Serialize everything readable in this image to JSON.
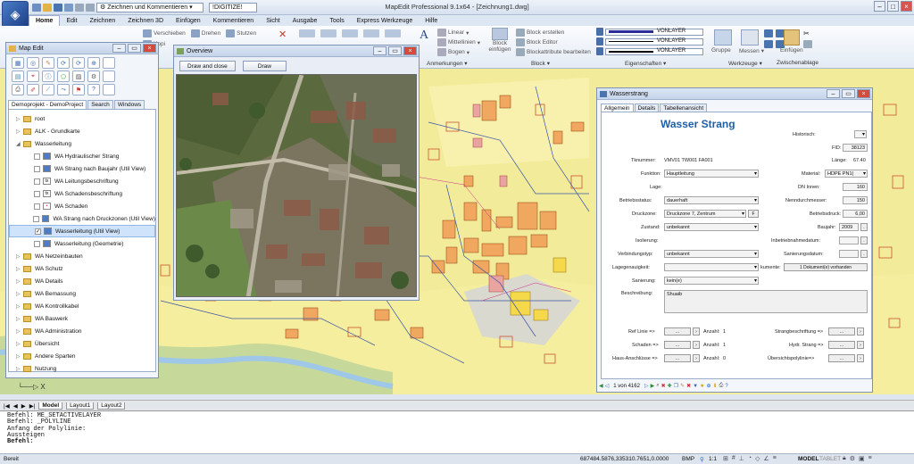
{
  "app": {
    "title": "MapEdit Professional 9.1x64 - [Zeichnung1.dwg]",
    "workspace": "Zeichnen und Kommentieren",
    "digitize_tag": "DIGITIZE"
  },
  "menu": [
    "Home",
    "Edit",
    "Zeichnen",
    "Zeichnen 3D",
    "Einfügen",
    "Kommentieren",
    "Sicht",
    "Ausgabe",
    "Tools",
    "Express Werkzeuge",
    "Hilfe"
  ],
  "ribbon": {
    "modify_buttons": [
      "Verschieben",
      "Drehen",
      "Stutzen",
      "Kopi"
    ],
    "linear": "Linear",
    "mittellinien": "Mittellinien",
    "bogen": "Bogen",
    "anmerkungen": "Anmerkungen",
    "block_einfuegen": "Block einfügen",
    "block_erstellen": "Block erstellen",
    "block_editor": "Block Editor",
    "blockattribute": "Blockattribute bearbeiten",
    "block_group": "Block",
    "layers": [
      "VONLAYER",
      "VONLAYER",
      "VONLAYER"
    ],
    "eigenschaften": "Eigenschaften",
    "gruppe": "Gruppe",
    "messen": "Messen",
    "werkzeuge": "Werkzeuge",
    "einfuegen": "Einfügen",
    "zwischenablage": "Zwischenablage"
  },
  "mapedit": {
    "title": "Map Edit",
    "tabs": [
      "Demoprojekt - DemoProject",
      "Search",
      "Windows"
    ],
    "tree": [
      {
        "label": "root",
        "level": 0,
        "type": "folder"
      },
      {
        "label": "ALK - Grundkarte",
        "level": 0,
        "type": "folder"
      },
      {
        "label": "Wasserleitung",
        "level": 0,
        "type": "folder",
        "expanded": true
      },
      {
        "label": "WA Hydraulischer Strang",
        "level": 1,
        "type": "layer"
      },
      {
        "label": "WA Strang nach Baujahr (Util View)",
        "level": 1,
        "type": "layer"
      },
      {
        "label": "WA Leitungsbeschriftung",
        "level": 1,
        "type": "text"
      },
      {
        "label": "WA Schadensbeschriftung",
        "level": 1,
        "type": "text"
      },
      {
        "label": "WA Schaden",
        "level": 1,
        "type": "point"
      },
      {
        "label": "WA Strang nach Druckzonen (Util View)",
        "level": 1,
        "type": "layer"
      },
      {
        "label": "Wasserleitung (Util View)",
        "level": 1,
        "type": "layer",
        "selected": true
      },
      {
        "label": "Wasserleitung (Geometrie)",
        "level": 1,
        "type": "layer"
      },
      {
        "label": "WA Netzeinbauten",
        "level": 0,
        "type": "folder"
      },
      {
        "label": "WA Schutz",
        "level": 0,
        "type": "folder"
      },
      {
        "label": "WA Details",
        "level": 0,
        "type": "folder"
      },
      {
        "label": "WA Bemassung",
        "level": 0,
        "type": "folder"
      },
      {
        "label": "WA Kontrollkabel",
        "level": 0,
        "type": "folder"
      },
      {
        "label": "WA Bauwerk",
        "level": 0,
        "type": "folder"
      },
      {
        "label": "WA Administration",
        "level": 0,
        "type": "folder"
      },
      {
        "label": "Übersicht",
        "level": 0,
        "type": "folder"
      },
      {
        "label": "Andere Sparten",
        "level": 0,
        "type": "folder"
      },
      {
        "label": "Nutzung",
        "level": 0,
        "type": "folder"
      }
    ]
  },
  "overview": {
    "title": "Overview",
    "btn_draw_close": "Draw and close",
    "btn_draw": "Draw"
  },
  "wasser": {
    "window_title": "Wasserstrang",
    "tabs": [
      "Allgemein",
      "Details",
      "Tabellenansicht"
    ],
    "heading": "Wasser Strang",
    "historisch_label": "Historisch:",
    "fid_label": "FID:",
    "fid": "38123",
    "tknummer_label": "Tknummer:",
    "tknummer": "VMV01 TW001 FA001",
    "laenge_label": "Länge:",
    "laenge": "67.40",
    "funktion_label": "Funktion:",
    "funktion": "Hauptleitung",
    "material_label": "Material:",
    "material": "HDPE PN1(",
    "lage_label": "Lage:",
    "dn_label": "DN Innen:",
    "dn": "160",
    "betriebsstatus_label": "Betriebsstatus:",
    "betriebsstatus": "dauerhaft",
    "nenn_label": "Nenndurchmesser:",
    "nenn": "150",
    "druckzone_label": "Druckzone:",
    "druckzone": "Druckzone 7, Zentrum",
    "druckzone_btn": "F",
    "betriebsdruck_label": "Betriebsdruck:",
    "betriebsdruck": "6,00",
    "zustand_label": "Zustand:",
    "zustand": "unbekannt",
    "baujahr_label": "Baujahr:",
    "baujahr": "2009",
    "isolierung_label": "Isolierung:",
    "inbetrieb_label": "Inbetriebnahmedatum:",
    "verbindung_label": "Verbindungstyp:",
    "verbindung": "unbekannt",
    "sanierungsdatum_label": "Sanierungsdatum:",
    "lagegenau_label": "Lagegenauigkeit:",
    "dokumente_label": "kumente:",
    "dokumente_btn": "1 Dokument(e) vorhanden",
    "sanierung_label": "Sanierung:",
    "sanierung": "kein(e)",
    "beschreibung_label": "Beschreibung:",
    "beschreibung": "Shuaib",
    "refs": [
      {
        "label": "Ref Linie =>",
        "anzahl_label": "Anzahl:",
        "anzahl": "1",
        "right": "Strangbeschriftung =>"
      },
      {
        "label": "Schaden =>",
        "anzahl_label": "Anzahl:",
        "anzahl": "1",
        "right": "Hydr. Strang =>"
      },
      {
        "label": "Haus-Anschlüsse =>",
        "anzahl_label": "Anzahl:",
        "anzahl": "0",
        "right": "Übersichtspolylinie=>"
      }
    ],
    "ref_btn": "...",
    "record": "1 von 4162"
  },
  "layout_tabs": [
    "Model",
    "Layout1",
    "Layout2"
  ],
  "command": [
    "Befehl: ME_SETACTIVELAYER",
    "Befehl: _POLYLINE",
    "Anfang der Polylinie:",
    "Aussteigen",
    "Befehl:"
  ],
  "status": {
    "left": "Bereit",
    "coords": "687484.5876,335310.7651,0.0000",
    "mode": "BMP",
    "scale": "1:1",
    "model": "MODEL",
    "tablet": "TABLET"
  },
  "colors": {
    "accent": "#1f5ea8",
    "map_yellow": "#f2ec9a",
    "map_bldg": "#f0a860",
    "map_green": "#c6d99a"
  }
}
